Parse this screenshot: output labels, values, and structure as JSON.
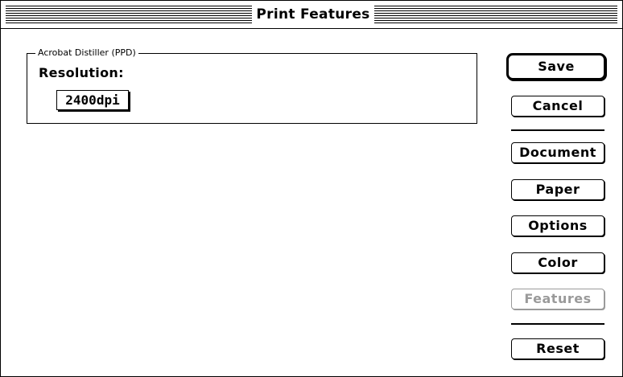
{
  "window": {
    "title": "Print Features"
  },
  "panel": {
    "group_label": "Acrobat Distiller (PPD)",
    "resolution_label": "Resolution:",
    "resolution_value": "2400dpi"
  },
  "buttons": {
    "save": "Save",
    "cancel": "Cancel",
    "document": "Document",
    "paper": "Paper",
    "options": "Options",
    "color": "Color",
    "features": "Features",
    "reset": "Reset"
  }
}
